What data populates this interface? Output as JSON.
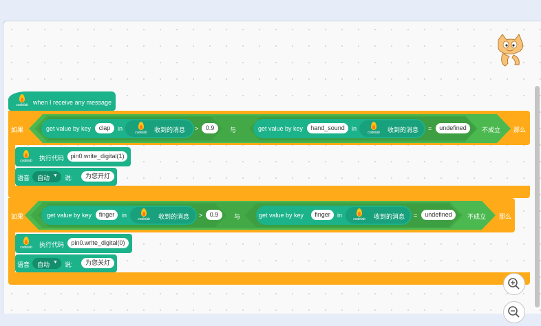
{
  "hat_block": {
    "label": "when I receive any message",
    "logo_caption": "codelab"
  },
  "if_block_1": {
    "if_label": "如果",
    "left_reporter": {
      "label": "get value by key",
      "key": "clap",
      "in_label": "in",
      "source_label": "收到的消息"
    },
    "left_op": ">",
    "left_value": "0.9",
    "and_label": "与",
    "right_reporter": {
      "label": "get value by key",
      "key": "hand_sound",
      "in_label": "in",
      "source_label": "收到的消息"
    },
    "right_op": "=",
    "right_value": "undefined",
    "not_label": "不成立",
    "then_label": "那么",
    "exec_block": {
      "label": "执行代码",
      "code": "pin0.write_digital(1)"
    },
    "speech_block": {
      "voice_label": "语音",
      "voice_value": "自动",
      "say_label": "说:",
      "say_text": "为您开灯"
    }
  },
  "if_block_2": {
    "if_label": "如果",
    "left_reporter": {
      "label": "get value by key",
      "key": "finger",
      "in_label": "in",
      "source_label": "收到的消息"
    },
    "left_op": ">",
    "left_value": "0.9",
    "and_label": "与",
    "right_reporter": {
      "label": "get value by key",
      "key": "finger",
      "in_label": "in",
      "source_label": "收到的消息"
    },
    "right_op": "=",
    "right_value": "undefined",
    "not_label": "不成立",
    "then_label": "那么",
    "exec_block": {
      "label": "执行代码",
      "code": "pin0.write_digital(0)"
    },
    "speech_block": {
      "voice_label": "语音",
      "voice_value": "自动",
      "say_label": "说:",
      "say_text": "为您关灯"
    }
  },
  "zoom": {
    "in_icon": "zoom-in-icon",
    "out_icon": "zoom-out-icon"
  },
  "mascot_icon": "scratch-cat-icon",
  "colors": {
    "control": "#ffab19",
    "extension": "#1cb28a",
    "operator": "#4cb950"
  }
}
